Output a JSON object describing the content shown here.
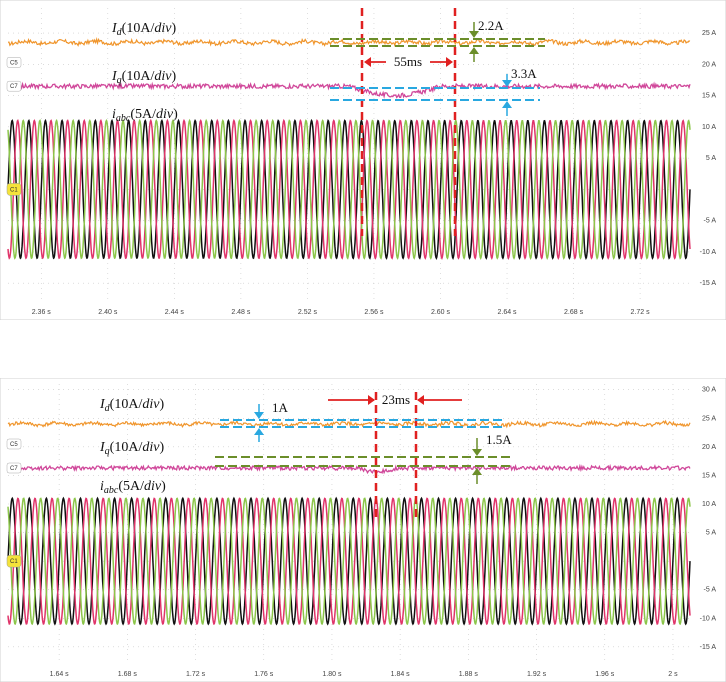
{
  "chart_data": [
    {
      "type": "line",
      "title": "",
      "x_range": [
        2.34,
        2.75
      ],
      "x_ticks": [
        "2.36 s",
        "2.40 s",
        "2.44 s",
        "2.48 s",
        "2.52 s",
        "2.56 s",
        "2.60 s",
        "2.64 s",
        "2.68 s",
        "2.72 s"
      ],
      "x_tick_values": [
        2.36,
        2.4,
        2.44,
        2.48,
        2.52,
        2.56,
        2.6,
        2.64,
        2.68,
        2.72
      ],
      "y_ticks": [
        "25 A",
        "20 A",
        "15 A",
        "10 A",
        "5 A",
        "",
        "-5 A",
        "-10 A",
        "-15 A"
      ],
      "y_tick_values": [
        25,
        20,
        15,
        10,
        5,
        0,
        -5,
        -10,
        -15
      ],
      "y_range": [
        -18,
        29
      ],
      "channel_labels": [
        "C5",
        "C7",
        "C1"
      ],
      "series": [
        {
          "name": "Id(10A/div)",
          "level": 23.5,
          "color": "#f0952b"
        },
        {
          "name": "Iq(10A/div)",
          "level": 16.5,
          "color": "#d0479a",
          "dip_amount": 3.3,
          "dip_start": 2.545,
          "dip_end": 2.6
        },
        {
          "name": "iabc(5A/div)",
          "amplitude": 11,
          "frequency_hz": 100,
          "colors": [
            "#111111",
            "#e0356a",
            "#8cc64a"
          ]
        }
      ],
      "labels": {
        "id": {
          "main": "I",
          "sub": "d",
          "unit": "(10A/div)"
        },
        "iq": {
          "main": "I",
          "sub": "q",
          "unit": "(10A/div)"
        },
        "iabc": {
          "main": "i",
          "sub": "abc",
          "unit": "(5A/div)"
        }
      },
      "annotations": {
        "time": "55ms",
        "id_band": "2.2A",
        "iq_band": "3.3A"
      },
      "colors": {
        "marker": "#e02020",
        "band_green": "#6b8e2a",
        "band_blue": "#29a8e0"
      }
    },
    {
      "type": "line",
      "title": "",
      "x_range": [
        1.61,
        2.01
      ],
      "x_ticks": [
        "1.64 s",
        "1.68 s",
        "1.72 s",
        "1.76 s",
        "1.80 s",
        "1.84 s",
        "1.88 s",
        "1.92 s",
        "1.96 s",
        "2 s"
      ],
      "x_tick_values": [
        1.64,
        1.68,
        1.72,
        1.76,
        1.8,
        1.84,
        1.88,
        1.92,
        1.96,
        2.0
      ],
      "y_ticks": [
        "30 A",
        "25 A",
        "20 A",
        "15 A",
        "10 A",
        "5 A",
        "",
        "-5 A",
        "-10 A",
        "-15 A"
      ],
      "y_tick_values": [
        30,
        25,
        20,
        15,
        10,
        5,
        0,
        -5,
        -10,
        -15
      ],
      "y_range": [
        -18,
        31
      ],
      "channel_labels": [
        "C5",
        "C7",
        "C1"
      ],
      "series": [
        {
          "name": "Id(10A/div)",
          "level": 24.0,
          "color": "#f0952b"
        },
        {
          "name": "Iq(10A/div)",
          "level": 16.3,
          "color": "#d0479a",
          "dip_amount": 1.5,
          "dip_start": 1.815,
          "dip_end": 1.838
        },
        {
          "name": "iabc(5A/div)",
          "amplitude": 11,
          "frequency_hz": 100,
          "colors": [
            "#111111",
            "#e0356a",
            "#8cc64a"
          ]
        }
      ],
      "labels": {
        "id": {
          "main": "I",
          "sub": "d",
          "unit": "(10A/div)"
        },
        "iq": {
          "main": "I",
          "sub": "q",
          "unit": "(10A/div)"
        },
        "iabc": {
          "main": "i",
          "sub": "abc",
          "unit": "(5A/div)"
        }
      },
      "annotations": {
        "time": "23ms",
        "id_band": "1A",
        "iq_band": "1.5A"
      },
      "colors": {
        "marker": "#e02020",
        "band_green": "#6b8e2a",
        "band_blue": "#29a8e0"
      }
    }
  ]
}
